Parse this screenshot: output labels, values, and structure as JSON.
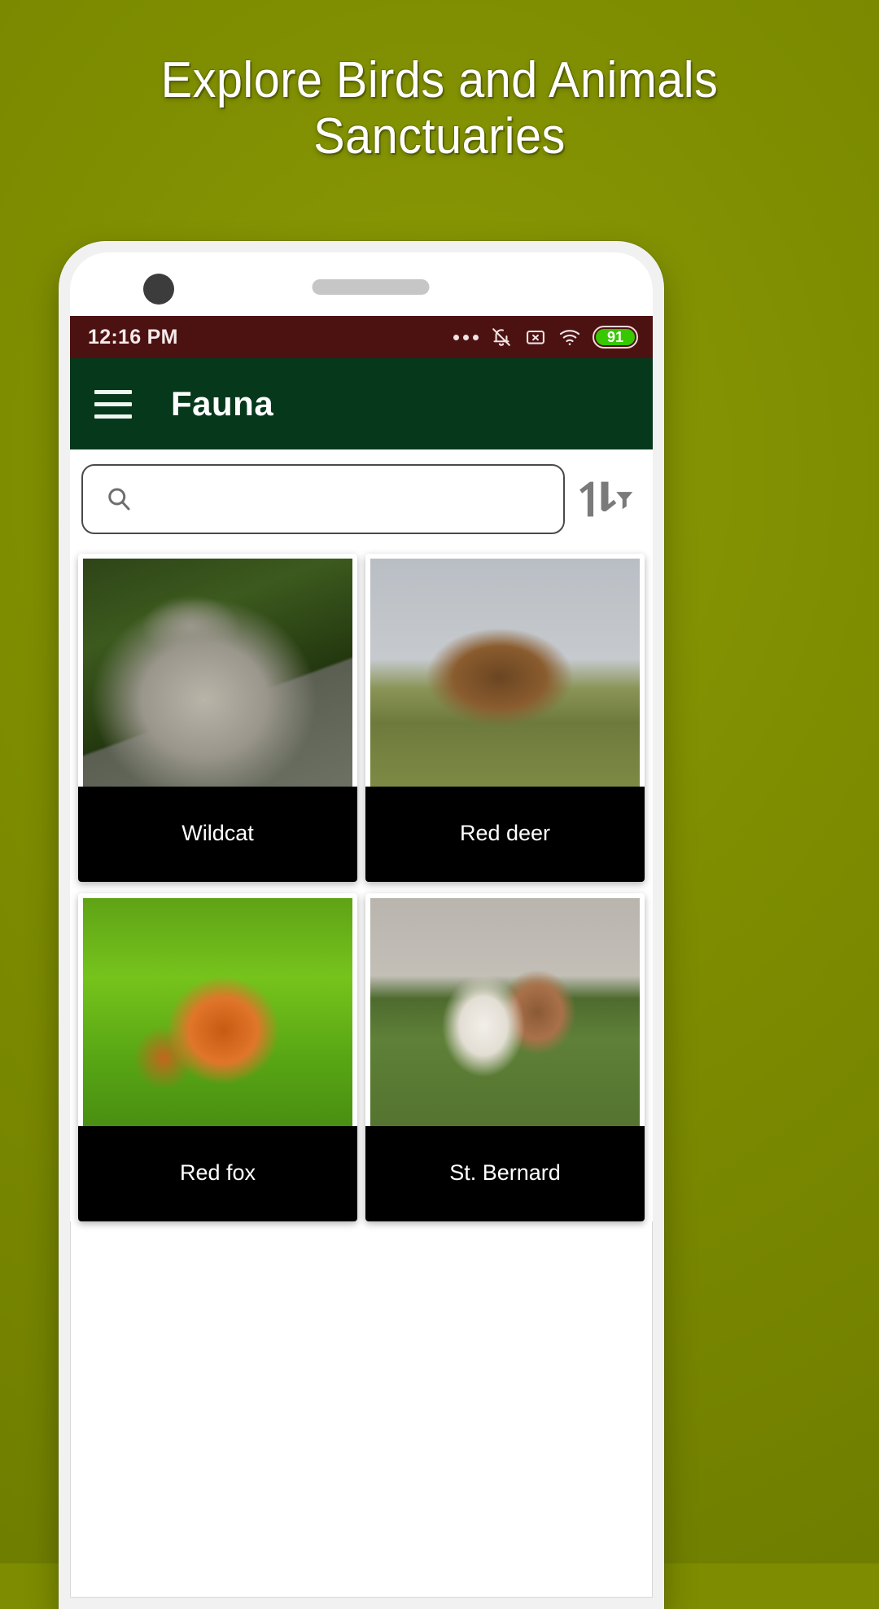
{
  "promo": {
    "line1": "Explore Birds and Animals",
    "line2": "Sanctuaries",
    "background_color": "#7d8c00",
    "text_color": "#ffffff"
  },
  "phone": {
    "notch": {
      "camera_icon": "camera-dot",
      "speaker_icon": "speaker-grill"
    }
  },
  "statusbar": {
    "time": "12:16 PM",
    "background_color": "#4c1212",
    "icons": [
      {
        "name": "more-dots-icon",
        "label": "..."
      },
      {
        "name": "notifications-off-icon",
        "label": "Silent"
      },
      {
        "name": "x-box-icon",
        "label": "No SIM"
      },
      {
        "name": "wifi-icon",
        "label": "Wi-Fi"
      }
    ],
    "battery": {
      "percent": "91",
      "fill_color": "#37c800"
    }
  },
  "appbar": {
    "menu_icon": "hamburger-menu-icon",
    "title": "Fauna",
    "background_color": "#06381c",
    "title_color": "#ffffff"
  },
  "search": {
    "icon": "search-icon",
    "value": "",
    "placeholder": "",
    "sort_icon": "sort-filter-icon"
  },
  "grid": {
    "cards": [
      {
        "name": "Wildcat",
        "photo": "wildcat-photo",
        "photo_class": "ph-wildcat"
      },
      {
        "name": "Red deer",
        "photo": "red-deer-photo",
        "photo_class": "ph-deer"
      },
      {
        "name": "Red fox",
        "photo": "red-fox-photo",
        "photo_class": "ph-fox"
      },
      {
        "name": "St. Bernard",
        "photo": "st-bernard-photo",
        "photo_class": "ph-bernard"
      }
    ],
    "label_background": "#000000",
    "label_color": "#ffffff"
  }
}
